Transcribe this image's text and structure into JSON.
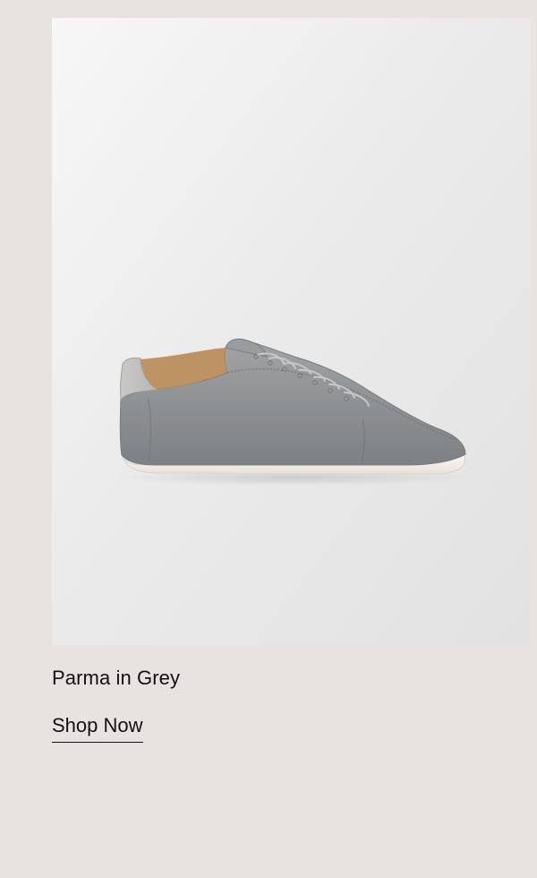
{
  "product": {
    "name": "Parma in Grey",
    "image_label": "grey suede sneaker image"
  },
  "cta": {
    "label": "Shop Now"
  },
  "colors": {
    "page_background": "#e8e3e0",
    "text": "#111111",
    "shoe_suede": "#8f9294",
    "shoe_sole": "#f1efe8",
    "shoe_lining": "#b88a55"
  }
}
